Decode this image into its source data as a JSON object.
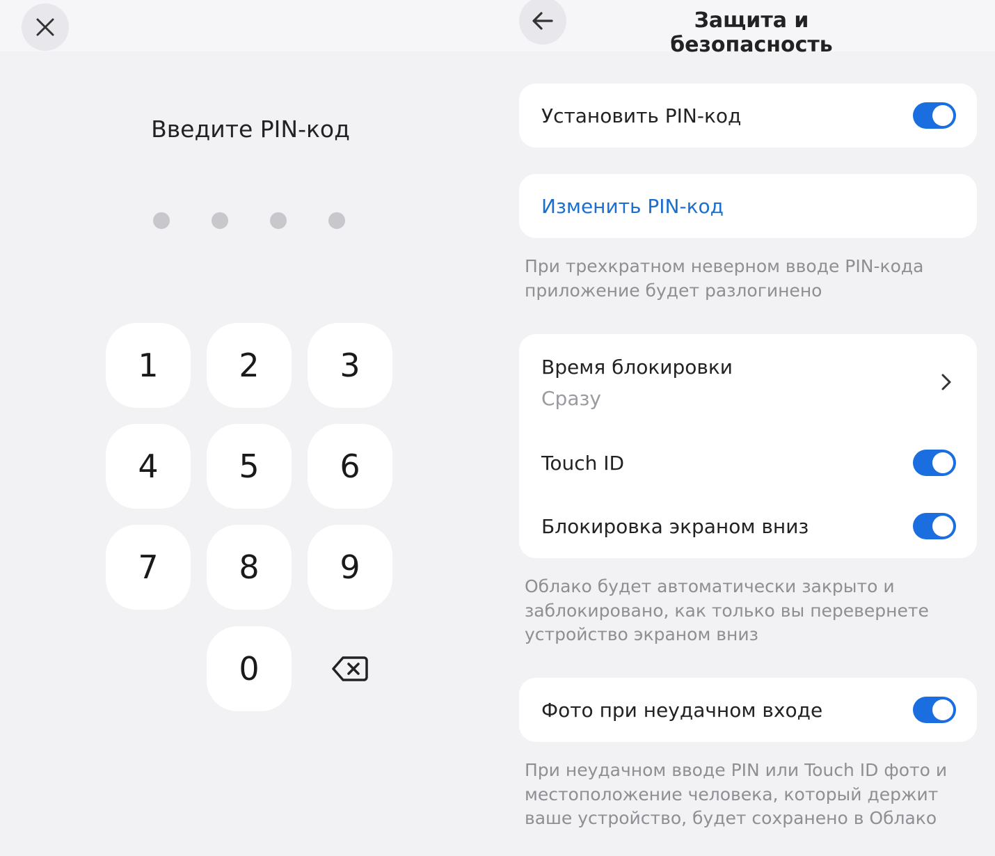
{
  "pin_screen": {
    "title": "Введите PIN-код",
    "entered_digits": 0,
    "pin_length": 4,
    "keys": [
      "1",
      "2",
      "3",
      "4",
      "5",
      "6",
      "7",
      "8",
      "9",
      "0"
    ],
    "close_icon": "close-icon",
    "backspace_icon": "backspace-icon"
  },
  "settings": {
    "header_title": "Защита и безопасность",
    "back_icon": "arrow-left-icon",
    "accent_color": "#1a6ee0",
    "set_pin": {
      "label": "Установить PIN-код",
      "enabled": true
    },
    "change_pin": {
      "label": "Изменить PIN-код"
    },
    "pin_note": "При трехкратном неверном вводе PIN-кода приложение будет разлогинено",
    "lock_time": {
      "label": "Время блокировки",
      "value": "Сразу"
    },
    "touch_id": {
      "label": "Touch ID",
      "enabled": true
    },
    "face_down_lock": {
      "label": "Блокировка экраном вниз",
      "enabled": true
    },
    "face_down_note": "Облако будет автоматически закрыто и заблокировано, как только вы перевернете устройство экраном вниз",
    "failed_photo": {
      "label": "Фото при неудачном входе",
      "enabled": true
    },
    "failed_photo_note": "При неудачном вводе PIN или Touch ID фото и местоположение человека, который держит ваше устройство, будет сохранено в Облако"
  }
}
